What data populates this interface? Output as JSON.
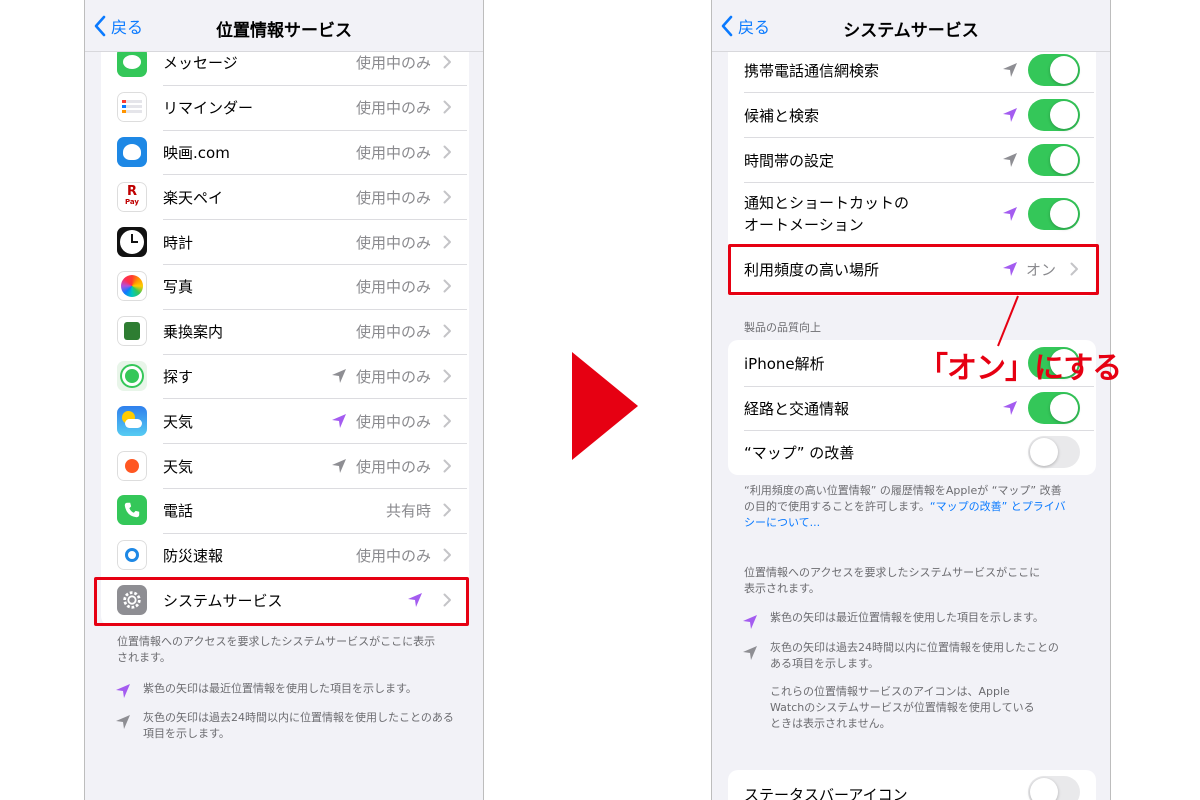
{
  "left_screen": {
    "back_label": "戻る",
    "title": "位置情報サービス",
    "apps": [
      {
        "label": "メッセージ",
        "value": "使用中のみ",
        "icon": "messages-icon",
        "arrow": "none"
      },
      {
        "label": "リマインダー",
        "value": "使用中のみ",
        "icon": "reminders-icon",
        "arrow": "none"
      },
      {
        "label": "映画.com",
        "value": "使用中のみ",
        "icon": "eiga-com-icon",
        "arrow": "none"
      },
      {
        "label": "楽天ペイ",
        "value": "使用中のみ",
        "icon": "rakuten-pay-icon",
        "arrow": "none"
      },
      {
        "label": "時計",
        "value": "使用中のみ",
        "icon": "clock-icon",
        "arrow": "none"
      },
      {
        "label": "写真",
        "value": "使用中のみ",
        "icon": "photos-icon",
        "arrow": "none"
      },
      {
        "label": "乗換案内",
        "value": "使用中のみ",
        "icon": "transit-icon",
        "arrow": "none"
      },
      {
        "label": "探す",
        "value": "使用中のみ",
        "icon": "find-my-icon",
        "arrow": "gray"
      },
      {
        "label": "天気",
        "value": "使用中のみ",
        "icon": "weather-icon",
        "arrow": "purple"
      },
      {
        "label": "天気",
        "value": "使用中のみ",
        "icon": "yahoo-weather-icon",
        "arrow": "gray"
      },
      {
        "label": "電話",
        "value": "共有時",
        "icon": "phone-icon",
        "arrow": "none"
      },
      {
        "label": "防災速報",
        "value": "使用中のみ",
        "icon": "disaster-alert-icon",
        "arrow": "none"
      },
      {
        "label": "システムサービス",
        "value": "",
        "icon": "gear-icon",
        "arrow": "purple"
      }
    ],
    "footer_text": "位置情報へのアクセスを要求したシステムサービスがここに表示されます。",
    "legend_purple": "紫色の矢印は最近位置情報を使用した項目を示します。",
    "legend_gray": "灰色の矢印は過去24時間以内に位置情報を使用したことのある項目を示します。"
  },
  "right_screen": {
    "back_label": "戻る",
    "title": "システムサービス",
    "services": [
      {
        "label": "携帯電話通信網検索",
        "arrow": "gray",
        "control": "on"
      },
      {
        "label": "候補と検索",
        "arrow": "purple",
        "control": "on"
      },
      {
        "label": "時間帯の設定",
        "arrow": "gray",
        "control": "on"
      },
      {
        "label": "通知とショートカットの",
        "label2": "オートメーション",
        "arrow": "purple",
        "control": "on"
      },
      {
        "label": "利用頻度の高い場所",
        "arrow": "purple",
        "control": "link",
        "value": "オン"
      }
    ],
    "section_header": "製品の品質向上",
    "quality_items": [
      {
        "label": "iPhone解析",
        "arrow": "none",
        "control": "on"
      },
      {
        "label": "経路と交通情報",
        "arrow": "purple",
        "control": "on"
      },
      {
        "label": "“マップ” の改善",
        "arrow": "none",
        "control": "off"
      }
    ],
    "quality_footer_1": "“利用頻度の高い位置情報” の履歴情報をAppleが “マップ” 改善",
    "quality_footer_2": "の目的で使用することを許可します。",
    "quality_footer_link_1": "“マップの改善” とプライバ",
    "quality_footer_link_2": "シーについて...",
    "footer_text_1": "位置情報へのアクセスを要求したシステムサービスがここに",
    "footer_text_2": "表示されます。",
    "legend_purple": "紫色の矢印は最近位置情報を使用した項目を示します。",
    "legend_gray_1": "灰色の矢印は過去24時間以内に位置情報を使用したことの",
    "legend_gray_2": "ある項目を示します。",
    "watch_note_1": "これらの位置情報サービスのアイコンは、Apple",
    "watch_note_2": "Watchのシステムサービスが位置情報を使用している",
    "watch_note_3": "ときは表示されません。",
    "status_bar_label": "ステータスバーアイコン"
  },
  "callout": {
    "text": "「オン」にする"
  },
  "colors": {
    "accent_blue": "#0a7aff",
    "toggle_green": "#34c759",
    "arrow_purple": "#a45cf0",
    "arrow_gray": "#8e8e93",
    "highlight_red": "#e60012"
  }
}
